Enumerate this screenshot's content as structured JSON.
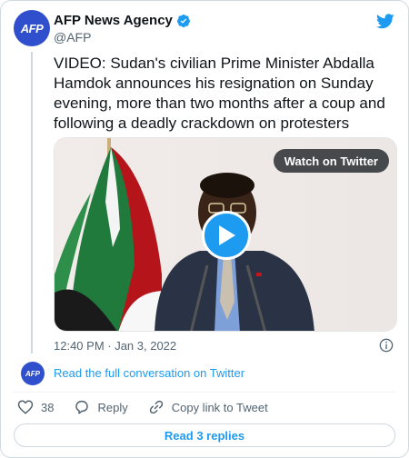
{
  "account": {
    "avatar_text": "AFP",
    "name": "AFP News Agency",
    "handle": "@AFP"
  },
  "tweet": {
    "text": "VIDEO: Sudan's civilian Prime Minister Abdalla Hamdok announces his resignation on Sunday evening, more than two months after a coup and following a deadly crackdown on protesters",
    "timestamp": "12:40 PM · Jan 3, 2022"
  },
  "media": {
    "watch_label": "Watch on Twitter"
  },
  "thread": {
    "avatar_text": "AFP",
    "link_label": "Read the full conversation on Twitter"
  },
  "actions": {
    "like_count": "38",
    "reply_label": "Reply",
    "copy_label": "Copy link to Tweet"
  },
  "footer": {
    "read_replies_label": "Read 3 replies"
  },
  "colors": {
    "brand_blue": "#1d9bf0",
    "afp_blue": "#2f4fcd",
    "secondary_text": "#536471"
  }
}
